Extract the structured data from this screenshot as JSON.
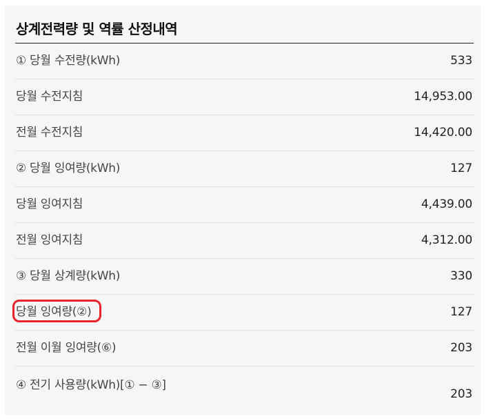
{
  "title": "상계전력량 및 역률 산정내역",
  "rows": [
    {
      "label": "① 당월 수전량(kWh)",
      "value": "533"
    },
    {
      "label": "당월 수전지침",
      "value": "14,953.00"
    },
    {
      "label": "전월 수전지침",
      "value": "14,420.00"
    },
    {
      "label": "② 당월 잉여량(kWh)",
      "value": "127"
    },
    {
      "label": "당월 잉여지침",
      "value": "4,439.00"
    },
    {
      "label": "전월 잉여지침",
      "value": "4,312.00"
    },
    {
      "label": "③ 당월 상계량(kWh)",
      "value": "330"
    },
    {
      "label": "당월 잉여량(②)",
      "value": "127"
    },
    {
      "label": "전월 이월 잉여량(⑥)",
      "value": "203"
    },
    {
      "label": "④ 전기 사용량(kWh)[① − ③]",
      "value": "203"
    }
  ],
  "annotation": {
    "color": "#e8232a"
  }
}
